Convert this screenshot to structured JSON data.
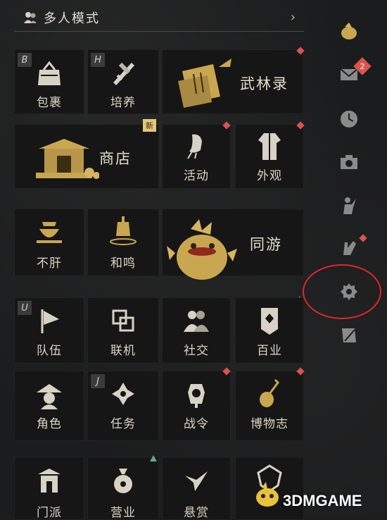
{
  "header": {
    "title": "多人模式",
    "chevron": "›"
  },
  "tiles": {
    "baoguo": {
      "label": "包裹",
      "key": "B"
    },
    "peiyang": {
      "label": "培养",
      "key": "H"
    },
    "wulinlu": {
      "label": "武林录"
    },
    "shangdian": {
      "label": "商店",
      "badge": "新"
    },
    "huodong": {
      "label": "活动"
    },
    "waiguan": {
      "label": "外观"
    },
    "bugan": {
      "label": "不肝"
    },
    "heming": {
      "label": "和鸣"
    },
    "tongyou": {
      "label": "同游"
    },
    "duiwu": {
      "label": "队伍",
      "key": "U"
    },
    "lianji": {
      "label": "联机"
    },
    "shejiao": {
      "label": "社交"
    },
    "baiye": {
      "label": "百业"
    },
    "juese": {
      "label": "角色"
    },
    "renwu": {
      "label": "任务",
      "key": "J"
    },
    "zhanling": {
      "label": "战令"
    },
    "bowuzhi": {
      "label": "博物志"
    },
    "row6a": {
      "label": "门派"
    },
    "row6b": {
      "label": "营业"
    },
    "row6c": {
      "label": "悬赏"
    }
  },
  "side": {
    "mail_count": "2"
  },
  "watermark": "3DMGAME",
  "colors": {
    "accent_red": "#d9534f",
    "gold": "#c9a650",
    "annotation": "#e02626"
  }
}
